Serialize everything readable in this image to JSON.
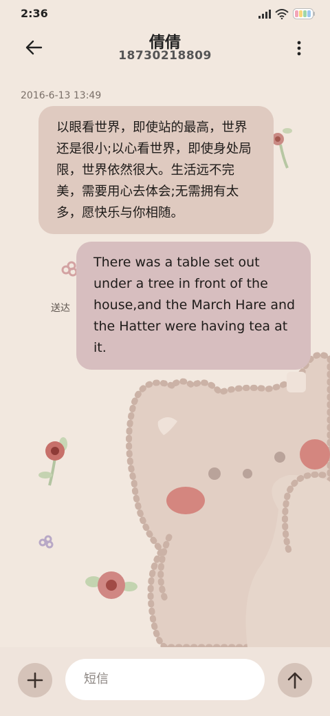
{
  "status_bar": {
    "time": "2:36"
  },
  "header": {
    "contact_name": "倩倩",
    "phone_number": "18730218809"
  },
  "conversation": {
    "timestamp": "2016-6-13 13:49",
    "incoming_message": "以眼看世界，即使站的最高，世界还是很小;以心看世界，即使身处局限，世界依然很大。生活远不完美，需要用心去体会;无需拥有太多，愿快乐与你相随。",
    "outgoing_message": "There was a table set out under a tree in front of the house,and the March Hare and the Hatter were having tea at it.",
    "delivery_status": "送达"
  },
  "composer": {
    "placeholder": "短信"
  },
  "colors": {
    "background": "#f2e8df",
    "incoming_bubble": "#dfcac0",
    "outgoing_bubble": "#d7bebf",
    "action_button": "#d5c3b9"
  },
  "icons": {
    "back": "arrow-left-icon",
    "more": "more-vertical-icon",
    "attach": "plus-icon",
    "send": "arrow-up-icon",
    "signal": "signal-icon",
    "wifi": "wifi-icon",
    "battery": "battery-icon"
  }
}
